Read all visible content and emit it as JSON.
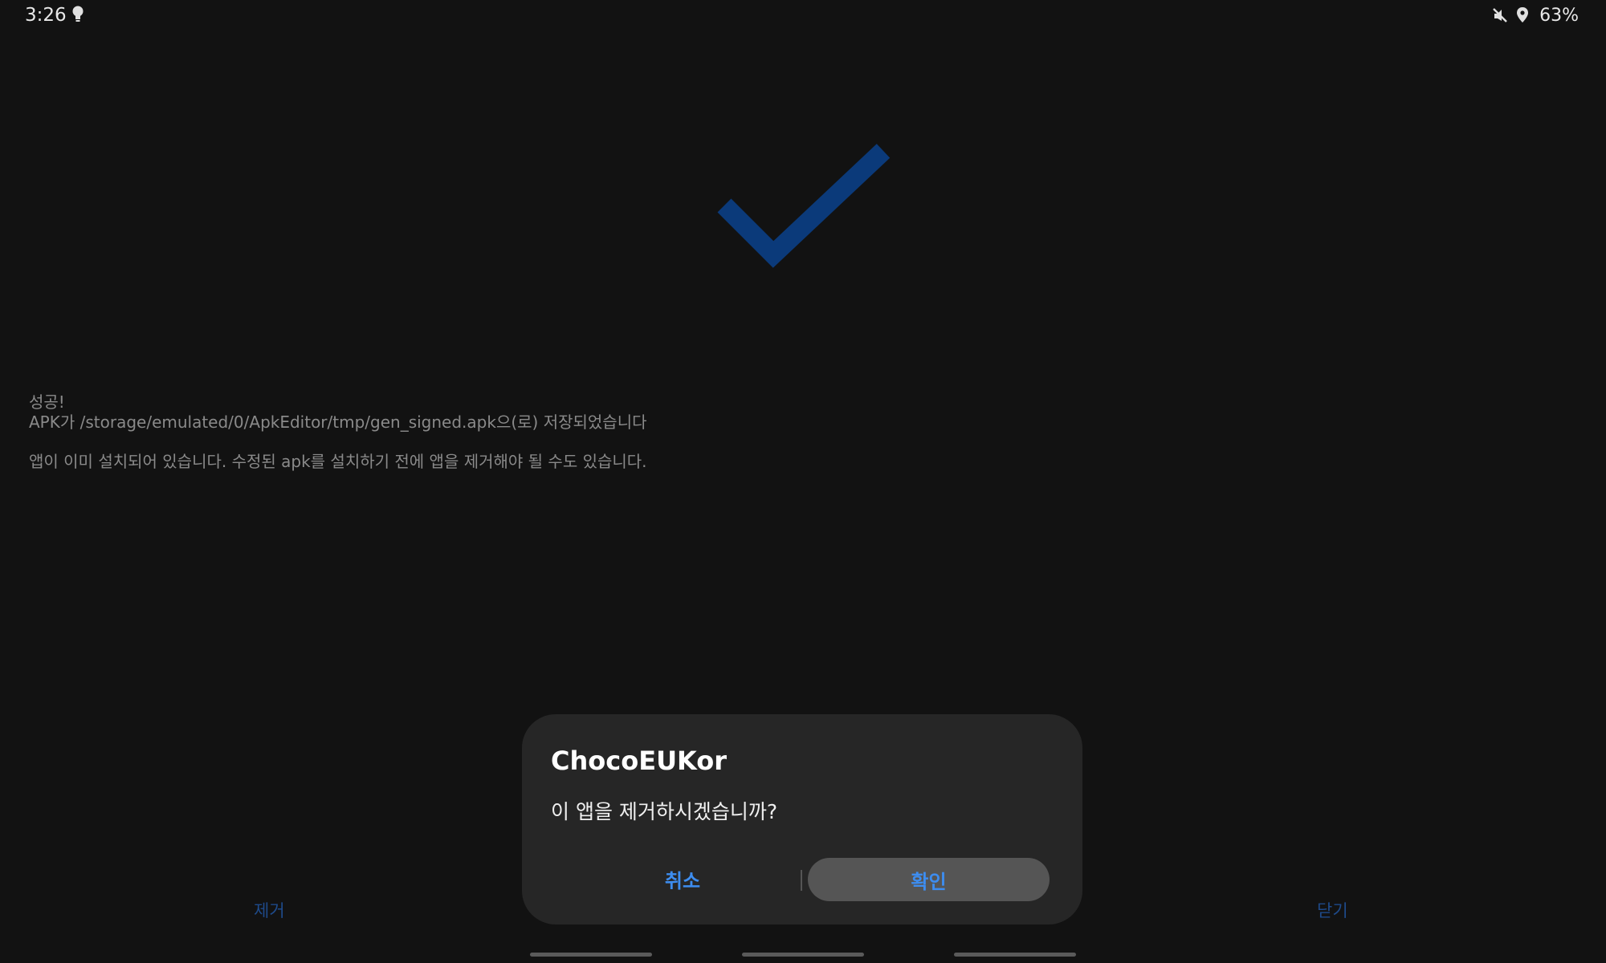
{
  "status_bar": {
    "time": "3:26",
    "battery": "63%",
    "icons": [
      "bulb-icon",
      "mute-icon",
      "location-icon"
    ]
  },
  "background": {
    "success_title": "성공!",
    "saved_path_message": "APK가 /storage/emulated/0/ApkEditor/tmp/gen_signed.apk으(로) 저장되었습니다",
    "installed_note": "앱이 이미 설치되어 있습니다. 수정된 apk를 설치하기 전에 앱을 제거해야 될 수도 있습니다.",
    "remove_button": "제거",
    "close_button": "닫기",
    "checkmark_color": "#0b3a7a"
  },
  "dialog": {
    "title": "ChocoEUKor",
    "message": "이 앱을 제거하시겠습니까?",
    "cancel_label": "취소",
    "confirm_label": "확인",
    "accent_color": "#3d8df0"
  }
}
